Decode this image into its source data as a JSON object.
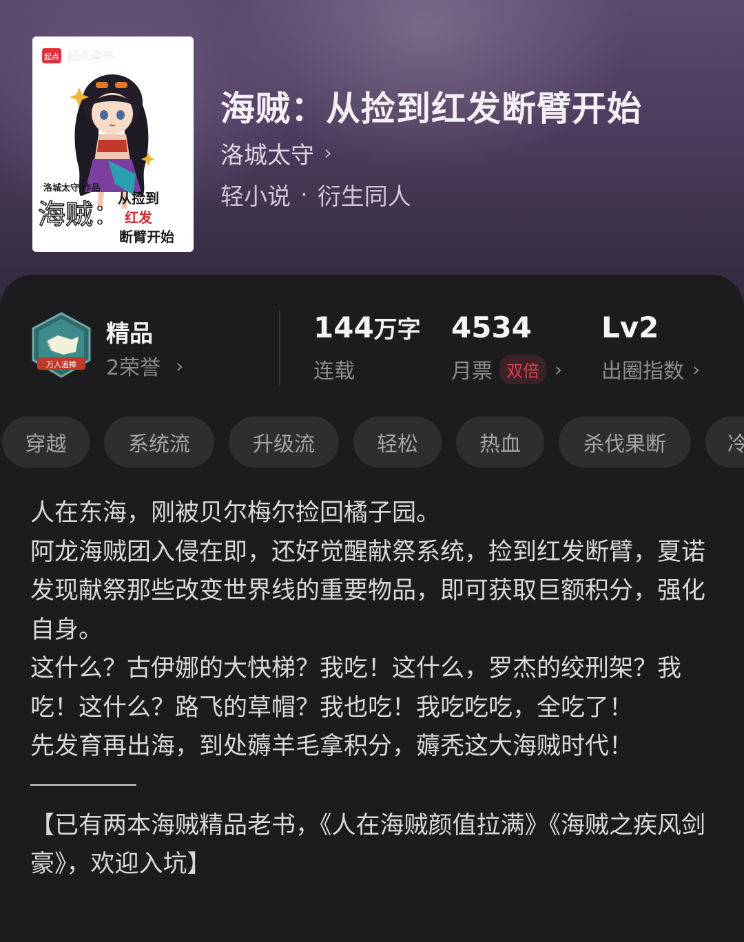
{
  "book": {
    "title": "海贼：从捡到红发断臂开始",
    "author": "洛城太守",
    "genre_primary": "轻小说",
    "genre_separator": "·",
    "genre_secondary": "衍生同人"
  },
  "cover": {
    "brand_badge": "起点",
    "brand_name": "起点读书",
    "byline": "洛城太守 作品",
    "title_part1": "海贼：",
    "title_part2": "从捡到",
    "title_part3": "红发",
    "title_part4": "断臂开始"
  },
  "stats": {
    "grade_badge_text": "万人追捧",
    "grade": "精品",
    "honor": "2荣誉",
    "word_count_number": "144",
    "word_count_unit": "万字",
    "status": "连载",
    "monthly_tickets": "4534",
    "monthly_tickets_label": "月票",
    "double_badge": "双倍",
    "level": "Lv2",
    "level_label": "出圈指数"
  },
  "tags": [
    "穿越",
    "系统流",
    "升级流",
    "轻松",
    "热血",
    "杀伐果断",
    "冷"
  ],
  "synopsis": {
    "p1": "人在东海，刚被贝尔梅尔捡回橘子园。",
    "p2": "阿龙海贼团入侵在即，还好觉醒献祭系统，捡到红发断臂，夏诺发现献祭那些改变世界线的重要物品，即可获取巨额积分，强化自身。",
    "p3": "这什么？古伊娜的大快梯？我吃！这什么，罗杰的绞刑架？我吃！这什么？路飞的草帽？我也吃！我吃吃吃，全吃了！",
    "p4": "先发育再出海，到处薅羊毛拿积分，薅秃这大海贼时代！",
    "p5": "【已有两本海贼精品老书，《人在海贼颜值拉满》《海贼之疾风剑豪》，欢迎入坑】"
  },
  "colors": {
    "background": "#1c1c1e",
    "tag_background": "#2e2e30",
    "accent_red": "#e0424e",
    "header_purple": "#4a3c5c"
  },
  "icons": {
    "chevron": "chevron-right-icon",
    "grade_badge": "shield-badge-icon"
  }
}
